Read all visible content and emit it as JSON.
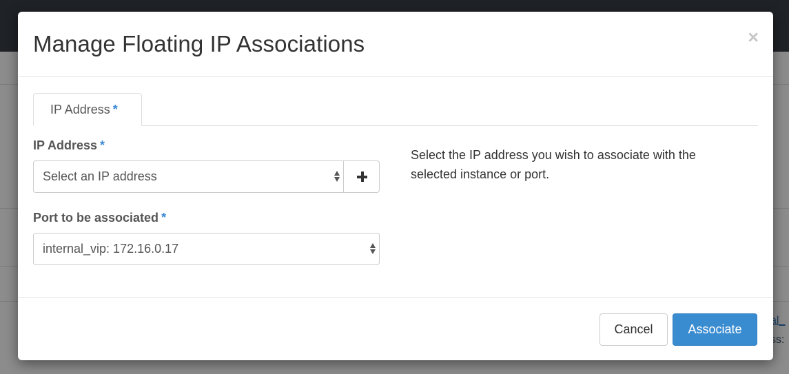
{
  "background": {
    "peek_line1": "al_",
    "peek_line2": "ss:"
  },
  "modal": {
    "title": "Manage Floating IP Associations",
    "close_glyph": "×"
  },
  "tabs": [
    {
      "label": "IP Address",
      "required_mark": "*"
    }
  ],
  "form": {
    "ip_address": {
      "label": "IP Address",
      "required_mark": "*",
      "value": "Select an IP address",
      "add_button_glyph": "+"
    },
    "port": {
      "label": "Port to be associated",
      "required_mark": "*",
      "value": "internal_vip: 172.16.0.17"
    }
  },
  "help_text": "Select the IP address you wish to associate with the selected instance or port.",
  "footer": {
    "cancel_label": "Cancel",
    "associate_label": "Associate"
  },
  "colors": {
    "primary": "#3a8cd1",
    "required": "#3b8ad3",
    "topbar": "#1f2226"
  }
}
